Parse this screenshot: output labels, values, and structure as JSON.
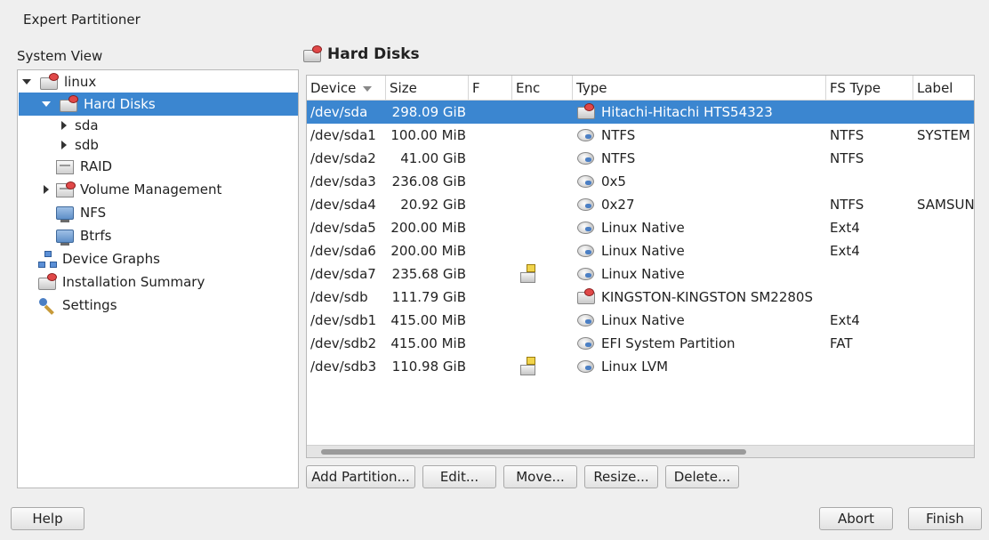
{
  "window": {
    "title": "Expert Partitioner"
  },
  "sidebar": {
    "label": "System View",
    "tree": [
      {
        "label": "linux",
        "expander": "expanded",
        "icon": "disk-icon"
      },
      {
        "label": "Hard Disks",
        "expander": "expanded",
        "icon": "disk-icon",
        "selected": true
      },
      {
        "label": "sda",
        "expander": "collapsed"
      },
      {
        "label": "sdb",
        "expander": "collapsed"
      },
      {
        "label": "RAID",
        "icon": "raid-icon"
      },
      {
        "label": "Volume Management",
        "expander": "collapsed",
        "icon": "volume-icon"
      },
      {
        "label": "NFS",
        "icon": "nfs-icon"
      },
      {
        "label": "Btrfs",
        "icon": "btrfs-icon"
      },
      {
        "label": "Device Graphs",
        "icon": "device-graph-icon"
      },
      {
        "label": "Installation Summary",
        "icon": "summary-icon"
      },
      {
        "label": "Settings",
        "icon": "settings-icon"
      }
    ]
  },
  "main": {
    "heading": "Hard Disks",
    "table": {
      "columns": [
        "Device",
        "Size",
        "F",
        "Enc",
        "Type",
        "FS Type",
        "Label"
      ],
      "sorted_by": "Device",
      "rows": [
        {
          "device": "/dev/sda",
          "size": "298.09 GiB",
          "f": "",
          "enc": false,
          "type": "Hitachi-Hitachi HTS54323",
          "type_icon": "disk-icon",
          "fs": "",
          "label": "",
          "selected": true
        },
        {
          "device": "/dev/sda1",
          "size": "100.00 MiB",
          "f": "",
          "enc": false,
          "type": "NTFS",
          "type_icon": "partition-icon",
          "fs": "NTFS",
          "label": "SYSTEM"
        },
        {
          "device": "/dev/sda2",
          "size": "41.00 GiB",
          "f": "",
          "enc": false,
          "type": "NTFS",
          "type_icon": "partition-icon",
          "fs": "NTFS",
          "label": ""
        },
        {
          "device": "/dev/sda3",
          "size": "236.08 GiB",
          "f": "",
          "enc": false,
          "type": "0x5",
          "type_icon": "partition-icon",
          "fs": "",
          "label": ""
        },
        {
          "device": "/dev/sda4",
          "size": "20.92 GiB",
          "f": "",
          "enc": false,
          "type": "0x27",
          "type_icon": "partition-icon",
          "fs": "NTFS",
          "label": "SAMSUN"
        },
        {
          "device": "/dev/sda5",
          "size": "200.00 MiB",
          "f": "",
          "enc": false,
          "type": "Linux Native",
          "type_icon": "partition-icon",
          "fs": "Ext4",
          "label": ""
        },
        {
          "device": "/dev/sda6",
          "size": "200.00 MiB",
          "f": "",
          "enc": false,
          "type": "Linux Native",
          "type_icon": "partition-icon",
          "fs": "Ext4",
          "label": ""
        },
        {
          "device": "/dev/sda7",
          "size": "235.68 GiB",
          "f": "",
          "enc": true,
          "type": "Linux Native",
          "type_icon": "partition-icon",
          "fs": "",
          "label": ""
        },
        {
          "device": "/dev/sdb",
          "size": "111.79 GiB",
          "f": "",
          "enc": false,
          "type": "KINGSTON-KINGSTON SM2280S",
          "type_icon": "disk-icon",
          "fs": "",
          "label": ""
        },
        {
          "device": "/dev/sdb1",
          "size": "415.00 MiB",
          "f": "",
          "enc": false,
          "type": "Linux Native",
          "type_icon": "partition-icon",
          "fs": "Ext4",
          "label": ""
        },
        {
          "device": "/dev/sdb2",
          "size": "415.00 MiB",
          "f": "",
          "enc": false,
          "type": "EFI System Partition",
          "type_icon": "partition-icon",
          "fs": "FAT",
          "label": ""
        },
        {
          "device": "/dev/sdb3",
          "size": "110.98 GiB",
          "f": "",
          "enc": true,
          "type": "Linux LVM",
          "type_icon": "partition-icon",
          "fs": "",
          "label": ""
        }
      ]
    },
    "actions": {
      "add_partition": "Add Partition...",
      "edit": "Edit...",
      "move": "Move...",
      "resize": "Resize...",
      "delete": "Delete..."
    }
  },
  "footer": {
    "help": "Help",
    "abort": "Abort",
    "finish": "Finish"
  },
  "colors": {
    "selection": "#3b86d0",
    "background": "#efefef"
  }
}
